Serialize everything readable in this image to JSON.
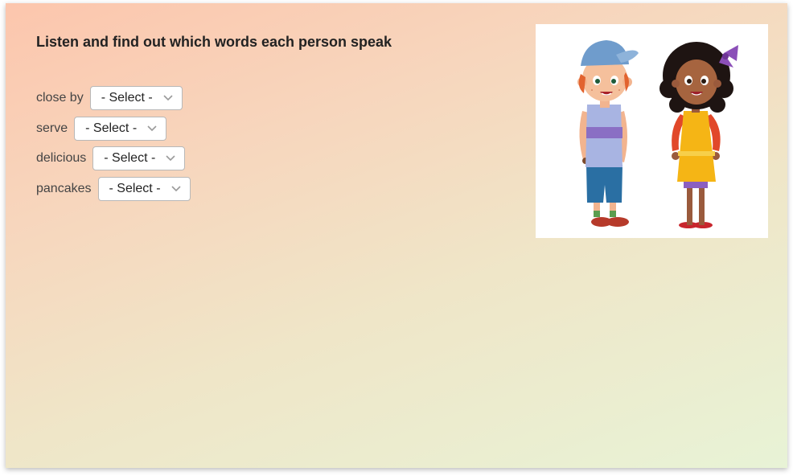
{
  "activity": {
    "title": "Listen and find out which words each person speak",
    "select_placeholder": "- Select -",
    "items": [
      {
        "word": "close by",
        "selected": "- Select -"
      },
      {
        "word": "serve",
        "selected": "- Select -"
      },
      {
        "word": "delicious",
        "selected": "- Select -"
      },
      {
        "word": "pancakes",
        "selected": "- Select -"
      }
    ]
  },
  "illustration": {
    "subject": "boy-and-girl-cartoon",
    "colors": {
      "cap": "#6f9ccc",
      "boy_shirt": "#a8b4e2",
      "boy_stripe": "#8a6fc4",
      "boy_shorts": "#2a6fa3",
      "girl_hair": "#1e1412",
      "girl_shirt": "#f5b515",
      "girl_sleeves": "#e1482a",
      "bow": "#8b4fb8"
    }
  },
  "theme": {
    "gradient_start": "#fcc6ad",
    "gradient_end": "#e8f3d6",
    "select_border": "#b8b8b8"
  }
}
